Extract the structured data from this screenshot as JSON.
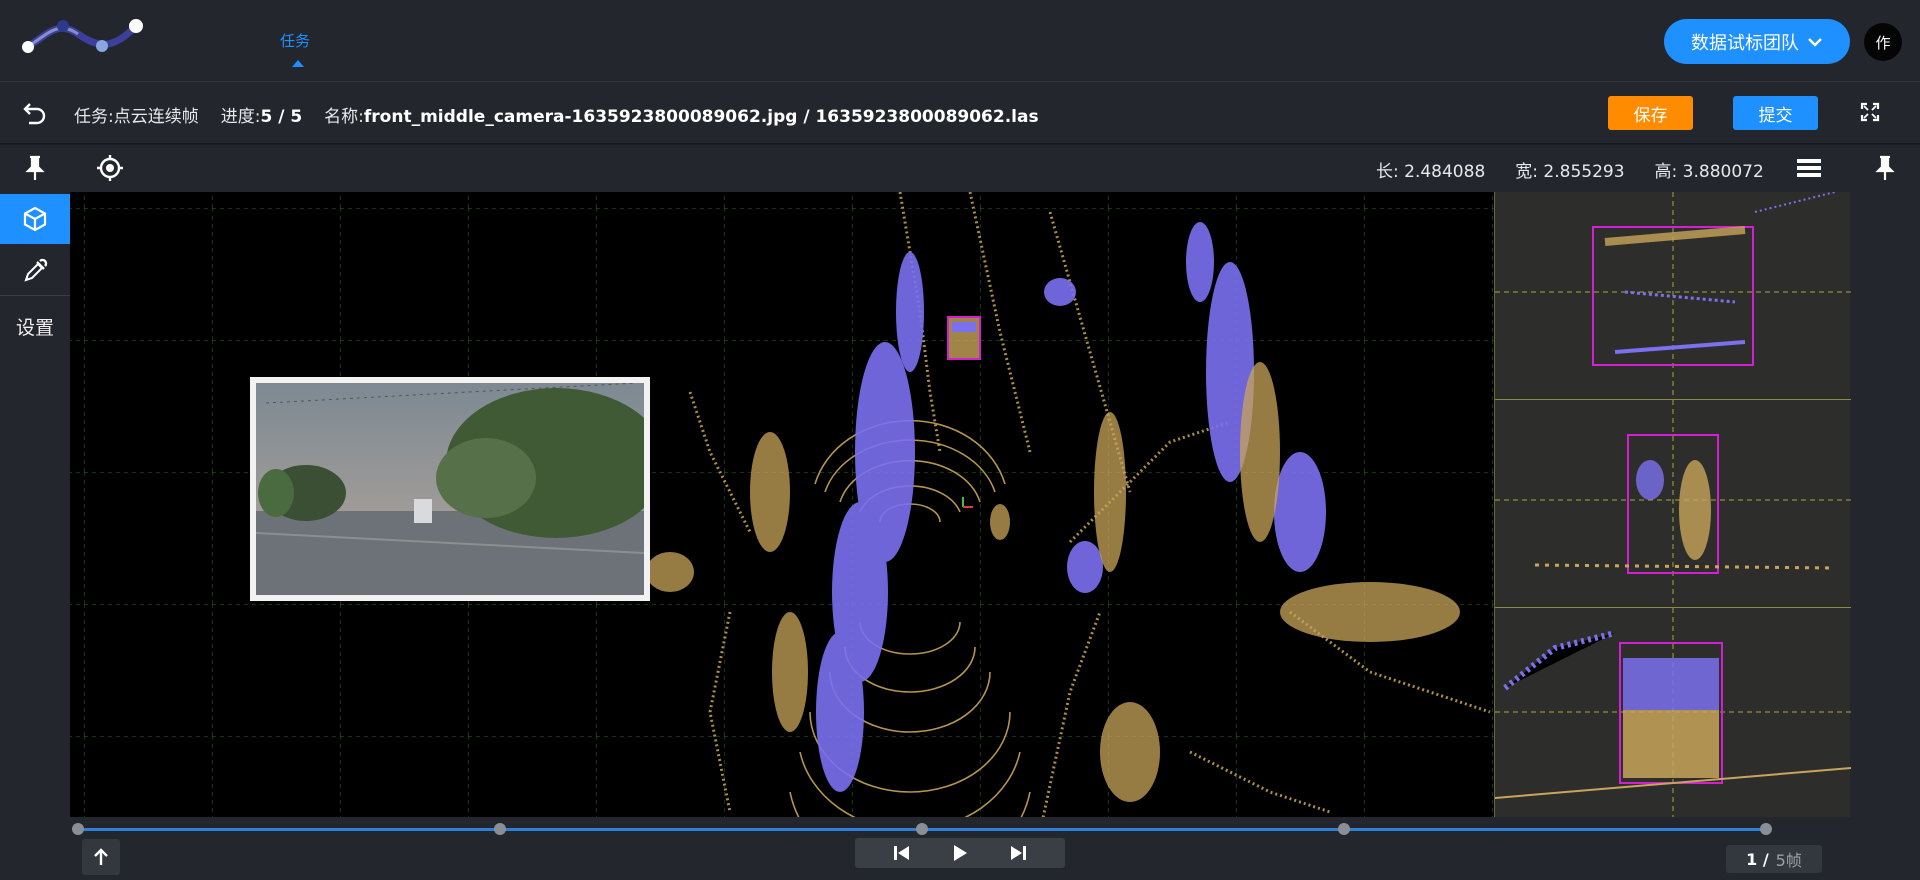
{
  "header": {
    "nav_tab": "任务",
    "team_label": "数据试标团队",
    "avatar_text": "作"
  },
  "info": {
    "task_label": "任务:",
    "task_value": "点云连续帧",
    "progress_label": "进度:",
    "progress_value": "5 / 5",
    "name_label": "名称:",
    "name_value": "front_middle_camera-1635923800089062.jpg / 1635923800089062.las",
    "save_label": "保存",
    "submit_label": "提交"
  },
  "dimensions": {
    "length_label": "长:",
    "length_value": "2.484088",
    "width_label": "宽:",
    "width_value": "2.855293",
    "height_label": "高:",
    "height_value": "3.880072"
  },
  "sidebar": {
    "settings_label": "设置"
  },
  "timeline": {
    "current_frame": "1 /",
    "total_frames": "5帧"
  },
  "colors": {
    "accent": "#1e90ff",
    "save": "#ff8c00",
    "points_ground": "#c8a55a",
    "points_objects": "#7b70f0",
    "bbox": "#d020d0"
  }
}
